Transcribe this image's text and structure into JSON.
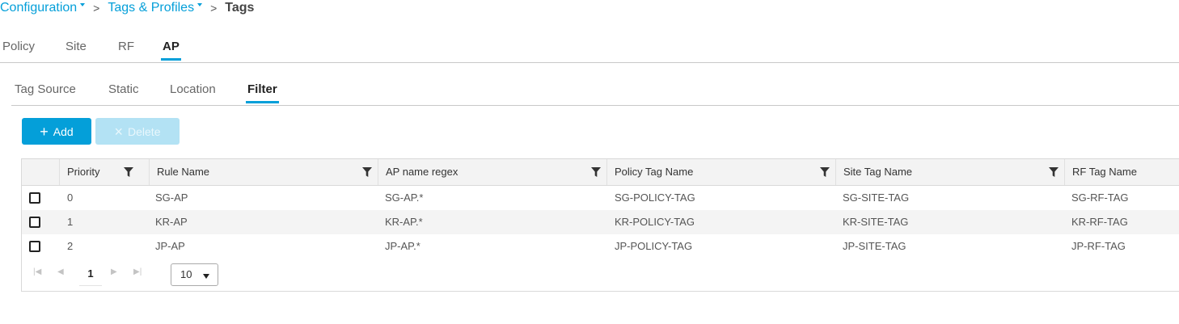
{
  "breadcrumb": {
    "items": [
      "Configuration",
      "Tags & Profiles"
    ],
    "current": "Tags",
    "separator": ">"
  },
  "top_tabs": [
    "Policy",
    "Site",
    "RF",
    "AP"
  ],
  "sub_tabs": [
    "Tag Source",
    "Static",
    "Location",
    "Filter"
  ],
  "actions": {
    "add_label": "Add",
    "delete_label": "Delete"
  },
  "table": {
    "columns": [
      "Priority",
      "Rule Name",
      "AP name regex",
      "Policy Tag Name",
      "Site Tag Name",
      "RF Tag Name"
    ],
    "rows": [
      [
        "0",
        "SG-AP",
        "SG-AP.*",
        "SG-POLICY-TAG",
        "SG-SITE-TAG",
        "SG-RF-TAG"
      ],
      [
        "1",
        "KR-AP",
        "KR-AP.*",
        "KR-POLICY-TAG",
        "KR-SITE-TAG",
        "KR-RF-TAG"
      ],
      [
        "2",
        "JP-AP",
        "JP-AP.*",
        "JP-POLICY-TAG",
        "JP-SITE-TAG",
        "JP-RF-TAG"
      ]
    ]
  },
  "pager": {
    "page": "1",
    "page_size": "10"
  },
  "colors": {
    "accent": "#049fd9",
    "disabled_button": "#b3e2f4"
  }
}
